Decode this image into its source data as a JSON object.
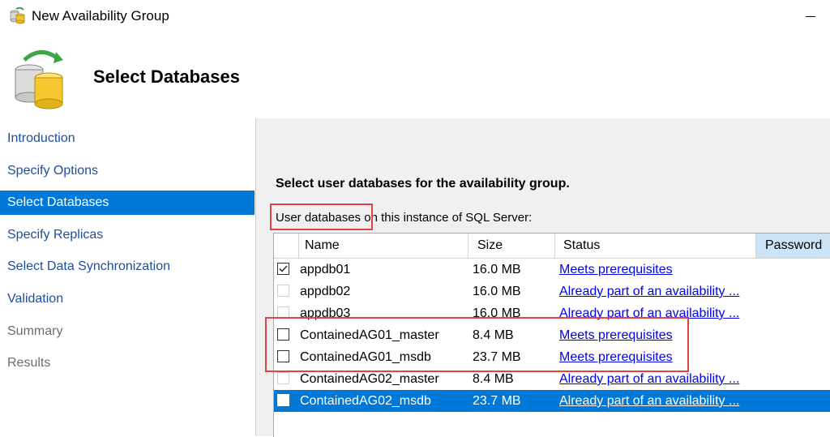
{
  "window": {
    "title": "New Availability Group"
  },
  "header": {
    "title": "Select Databases"
  },
  "nav": {
    "items": [
      {
        "label": "Introduction",
        "state": "normal"
      },
      {
        "label": "Specify Options",
        "state": "normal"
      },
      {
        "label": "Select Databases",
        "state": "selected"
      },
      {
        "label": "Specify Replicas",
        "state": "normal"
      },
      {
        "label": "Select Data Synchronization",
        "state": "normal"
      },
      {
        "label": "Validation",
        "state": "normal"
      },
      {
        "label": "Summary",
        "state": "disabled"
      },
      {
        "label": "Results",
        "state": "disabled"
      }
    ]
  },
  "main": {
    "instructions": "Select user databases for the availability group.",
    "label_prefix": "User databases",
    "label_suffix": " on this instance of SQL Server:",
    "columns": {
      "name": "Name",
      "size": "Size",
      "status": "Status",
      "password": "Password"
    },
    "rows": [
      {
        "name": "appdb01",
        "size": "16.0 MB",
        "status": "Meets prerequisites",
        "checked": true,
        "enabled": true
      },
      {
        "name": "appdb02",
        "size": "16.0 MB",
        "status": "Already part of an availability ...",
        "checked": false,
        "enabled": false
      },
      {
        "name": "appdb03",
        "size": "16.0 MB",
        "status": "Already part of an availability ...",
        "checked": false,
        "enabled": false
      },
      {
        "name": "ContainedAG01_master",
        "size": "8.4 MB",
        "status": "Meets prerequisites",
        "checked": false,
        "enabled": true
      },
      {
        "name": "ContainedAG01_msdb",
        "size": "23.7 MB",
        "status": "Meets prerequisites",
        "checked": false,
        "enabled": true
      },
      {
        "name": "ContainedAG02_master",
        "size": "8.4 MB",
        "status": "Already part of an availability ...",
        "checked": false,
        "enabled": false
      },
      {
        "name": "ContainedAG02_msdb",
        "size": "23.7 MB",
        "status": "Already part of an availability ...",
        "checked": false,
        "enabled": false,
        "selected": true
      }
    ]
  },
  "colors": {
    "accent": "#0078d7",
    "highlight": "#e04343",
    "link": "#0000ee",
    "nav_link": "#1f4e9c"
  }
}
